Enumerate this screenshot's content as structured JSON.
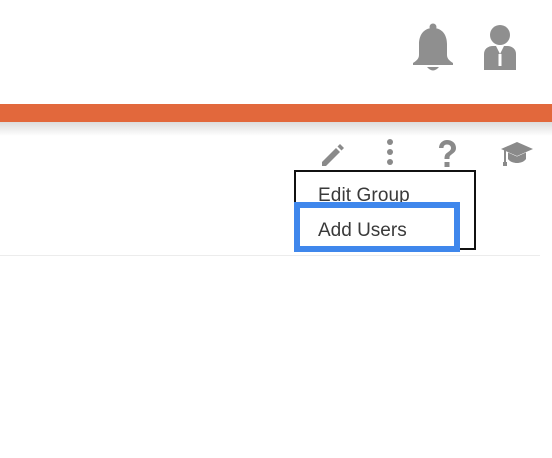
{
  "header": {
    "icons": {
      "notifications": "bell-icon",
      "profile": "user-icon"
    },
    "accent_color": "#e2683c"
  },
  "toolbar": {
    "icons": {
      "edit": "pencil-icon",
      "more": "more-vertical-icon",
      "help": "help-icon",
      "learn": "graduation-cap-icon"
    }
  },
  "dropdown": {
    "items": [
      {
        "label": "Edit Group"
      },
      {
        "label": "Add Users"
      }
    ],
    "highlight_color": "#3f87ec"
  }
}
